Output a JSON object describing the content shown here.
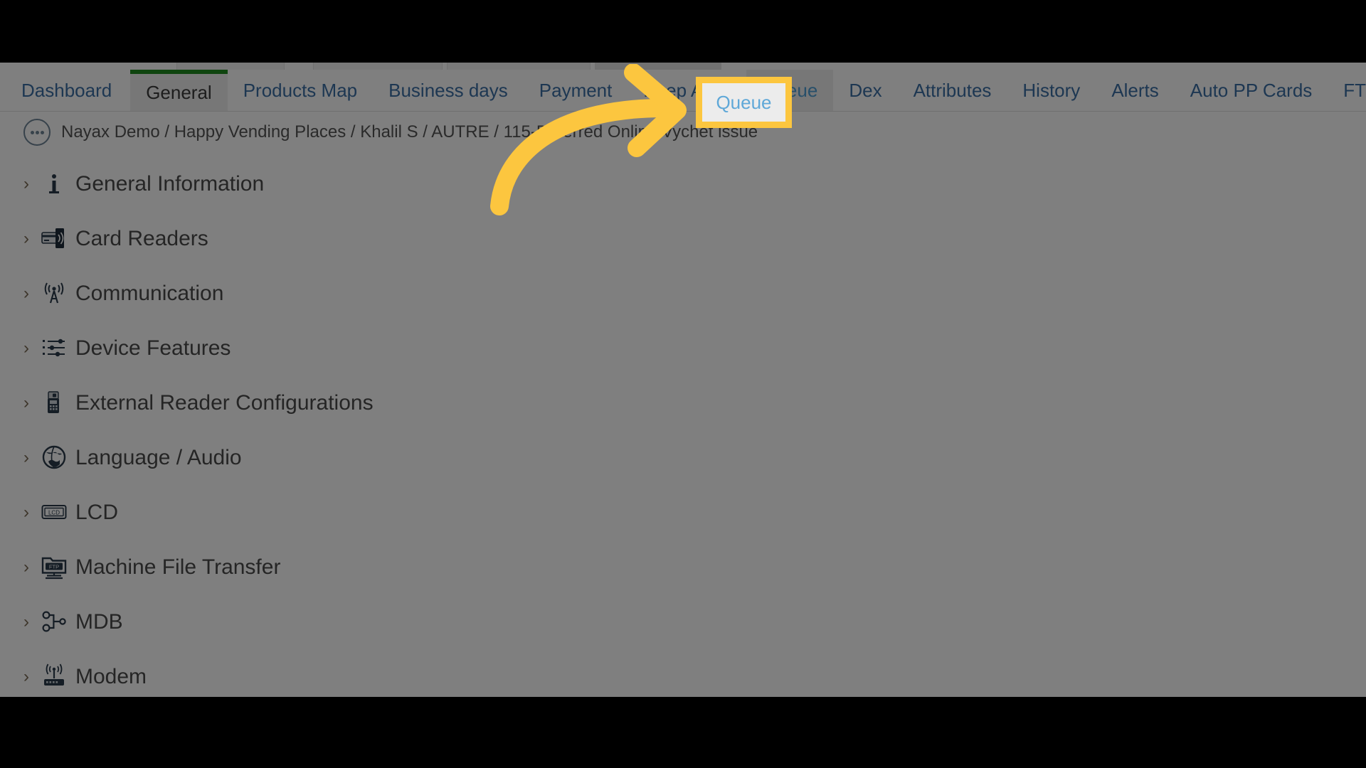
{
  "theme": {
    "accent_blue": "#3b6ea5",
    "active_tab_underline": "#1f8a1f",
    "highlight_yellow": "#fcc63f",
    "dim_overlay": "rgba(0,0,0,0.50)",
    "queue_tab_text": "#5fa8d8"
  },
  "tabs": [
    {
      "label": "Dashboard",
      "state": "normal"
    },
    {
      "label": "General",
      "state": "active"
    },
    {
      "label": "Products Map",
      "state": "normal"
    },
    {
      "label": "Business days",
      "state": "normal"
    },
    {
      "label": "Payment",
      "state": "normal"
    },
    {
      "label": "Keep Alive",
      "state": "normal"
    },
    {
      "label": "Queue",
      "state": "highlighted"
    },
    {
      "label": "Dex",
      "state": "normal"
    },
    {
      "label": "Attributes",
      "state": "normal"
    },
    {
      "label": "History",
      "state": "normal"
    },
    {
      "label": "Alerts",
      "state": "normal"
    },
    {
      "label": "Auto PP Cards",
      "state": "normal"
    },
    {
      "label": "FTL",
      "state": "normal"
    }
  ],
  "breadcrumb": {
    "menu_icon": "ellipsis-circle-icon",
    "path": "Nayax Demo / Happy Vending Places / Khalil S / AUTRE / 115-Deferred Online Vychet issue"
  },
  "sections": [
    {
      "label": "General Information",
      "icon": "info-icon",
      "expanded": false,
      "chevron": "›"
    },
    {
      "label": "Card Readers",
      "icon": "card-reader-icon",
      "expanded": false,
      "chevron": "›"
    },
    {
      "label": "Communication",
      "icon": "antenna-signal-icon",
      "expanded": false,
      "chevron": "›"
    },
    {
      "label": "Device Features",
      "icon": "sliders-icon",
      "expanded": false,
      "chevron": "›"
    },
    {
      "label": "External Reader Configurations",
      "icon": "card-terminal-icon",
      "expanded": false,
      "chevron": "›"
    },
    {
      "label": "Language / Audio",
      "icon": "globe-icon",
      "expanded": false,
      "chevron": "›"
    },
    {
      "label": "LCD",
      "icon": "lcd-screen-icon",
      "expanded": false,
      "chevron": "›"
    },
    {
      "label": "Machine File Transfer",
      "icon": "ftp-folder-icon",
      "expanded": false,
      "chevron": "›"
    },
    {
      "label": "MDB",
      "icon": "node-network-icon",
      "expanded": false,
      "chevron": "›"
    },
    {
      "label": "Modem",
      "icon": "modem-router-icon",
      "expanded": false,
      "chevron": "›"
    }
  ],
  "callout": {
    "arrow": "curved-arrow-pointing-right",
    "target_tab": "Queue",
    "highlight_label": "Queue"
  }
}
